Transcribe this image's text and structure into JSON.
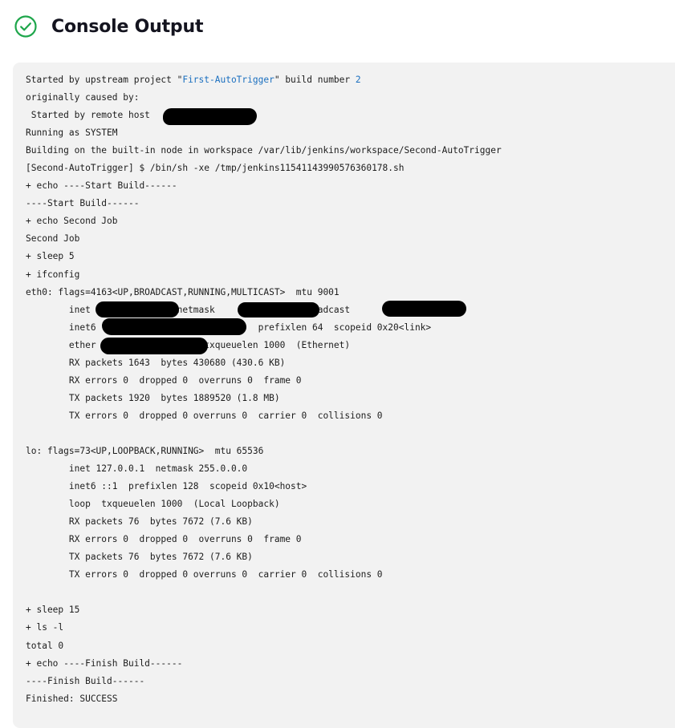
{
  "page": {
    "title": "Console Output",
    "status_icon": "check-circle-icon",
    "status_color": "#1ea64b",
    "link_color": "#1a6fbf",
    "panel_color": "#f2f2f2"
  },
  "console": {
    "header": {
      "started_prefix": "Started by upstream project \"",
      "project_link": "First-AutoTrigger",
      "started_suffix": "\" build number ",
      "build_number": "2"
    },
    "lines": [
      "originally caused by:",
      " Started by remote host ",
      "Running as SYSTEM",
      "Building on the built-in node in workspace /var/lib/jenkins/workspace/Second-AutoTrigger",
      "[Second-AutoTrigger] $ /bin/sh -xe /tmp/jenkins11541143990576360178.sh",
      "+ echo ----Start Build------",
      "----Start Build------",
      "+ echo Second Job",
      "Second Job",
      "+ sleep 5",
      "+ ifconfig",
      "eth0: flags=4163<UP,BROADCAST,RUNNING,MULTICAST>  mtu 9001",
      "        inet                netmask                broadcast",
      "        inet6                              prefixlen 64  scopeid 0x20<link>",
      "        ether                    txqueuelen 1000  (Ethernet)",
      "        RX packets 1643  bytes 430680 (430.6 KB)",
      "        RX errors 0  dropped 0  overruns 0  frame 0",
      "        TX packets 1920  bytes 1889520 (1.8 MB)",
      "        TX errors 0  dropped 0 overruns 0  carrier 0  collisions 0",
      "",
      "lo: flags=73<UP,LOOPBACK,RUNNING>  mtu 65536",
      "        inet 127.0.0.1  netmask 255.0.0.0",
      "        inet6 ::1  prefixlen 128  scopeid 0x10<host>",
      "        loop  txqueuelen 1000  (Local Loopback)",
      "        RX packets 76  bytes 7672 (7.6 KB)",
      "        RX errors 0  dropped 0  overruns 0  frame 0",
      "        TX packets 76  bytes 7672 (7.6 KB)",
      "        TX errors 0  dropped 0 overruns 0  carrier 0  collisions 0",
      "",
      "+ sleep 15",
      "+ ls -l",
      "total 0",
      "+ echo ----Finish Build------",
      "----Finish Build------",
      "Finished: SUCCESS"
    ]
  }
}
